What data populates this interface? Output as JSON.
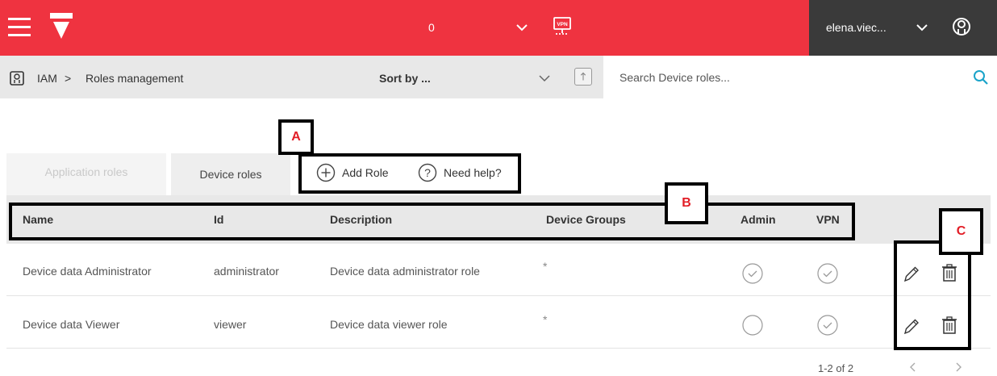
{
  "header": {
    "counter": "0",
    "username": "elena.viec..."
  },
  "breadcrumb": {
    "root": "IAM",
    "separator": ">",
    "page": "Roles management"
  },
  "toolbar": {
    "sort_label": "Sort by ...",
    "search_placeholder": "Search Device roles..."
  },
  "tabs": [
    {
      "label": "Application roles",
      "active": false
    },
    {
      "label": "Device roles",
      "active": true
    }
  ],
  "actions": {
    "add_role": "Add Role",
    "need_help": "Need help?"
  },
  "table": {
    "columns": [
      "Name",
      "Id",
      "Description",
      "Device Groups",
      "Admin",
      "VPN"
    ],
    "rows": [
      {
        "name": "Device data Administrator",
        "id": "administrator",
        "description": "Device data administrator role",
        "device_groups": "*",
        "admin": true,
        "vpn": true
      },
      {
        "name": "Device data Viewer",
        "id": "viewer",
        "description": "Device data viewer role",
        "device_groups": "*",
        "admin": false,
        "vpn": true
      }
    ]
  },
  "pagination": {
    "label": "1-2 of 2"
  },
  "annotations": {
    "a": "A",
    "b": "B",
    "c": "C"
  },
  "colors": {
    "brand": "#ef3340",
    "user_area": "#3a3a3a",
    "annotation": "#e21d26",
    "search_accent": "#1aa3c9"
  }
}
